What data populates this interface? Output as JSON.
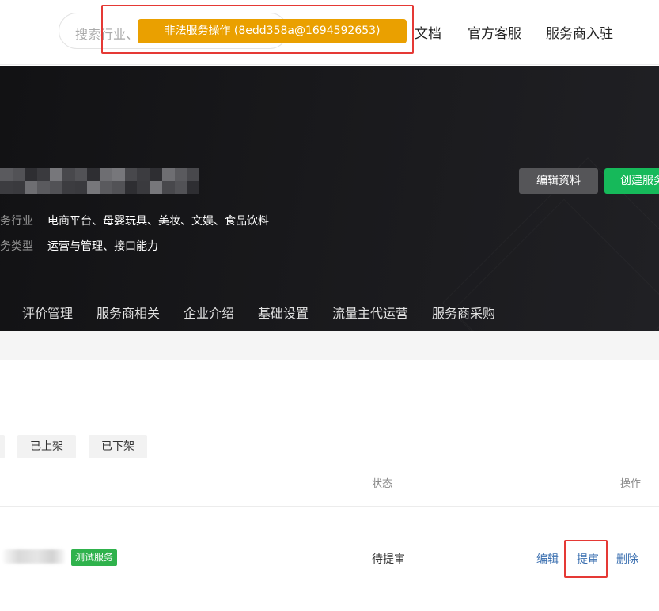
{
  "header": {
    "search_placeholder": "搜索行业、",
    "toast": "非法服务操作 (8edd358a@1694592653)",
    "links": [
      "文档",
      "官方客服",
      "服务商入驻"
    ]
  },
  "profile": {
    "industry_label": "务行业",
    "industry_value": "电商平台、母婴玩具、美妆、文娱、食品饮料",
    "type_label": "务类型",
    "type_value": "运营与管理、接口能力",
    "edit_button": "编辑资料",
    "create_button": "创建服务"
  },
  "tabs": [
    "评价管理",
    "服务商相关",
    "企业介绍",
    "基础设置",
    "流量主代运营",
    "服务商采购"
  ],
  "filters": [
    "已上架",
    "已下架"
  ],
  "table": {
    "headers": {
      "status": "状态",
      "actions": "操作"
    },
    "rows": [
      {
        "tag": "测试服务",
        "status": "待提审",
        "actions": [
          "编辑",
          "提审",
          "删除"
        ]
      }
    ]
  },
  "colors": {
    "toast": "#eaa000",
    "create_button": "#16b95a",
    "tag": "#2fb24c",
    "action_link": "#3a6fb0",
    "highlight": "#e53935"
  }
}
